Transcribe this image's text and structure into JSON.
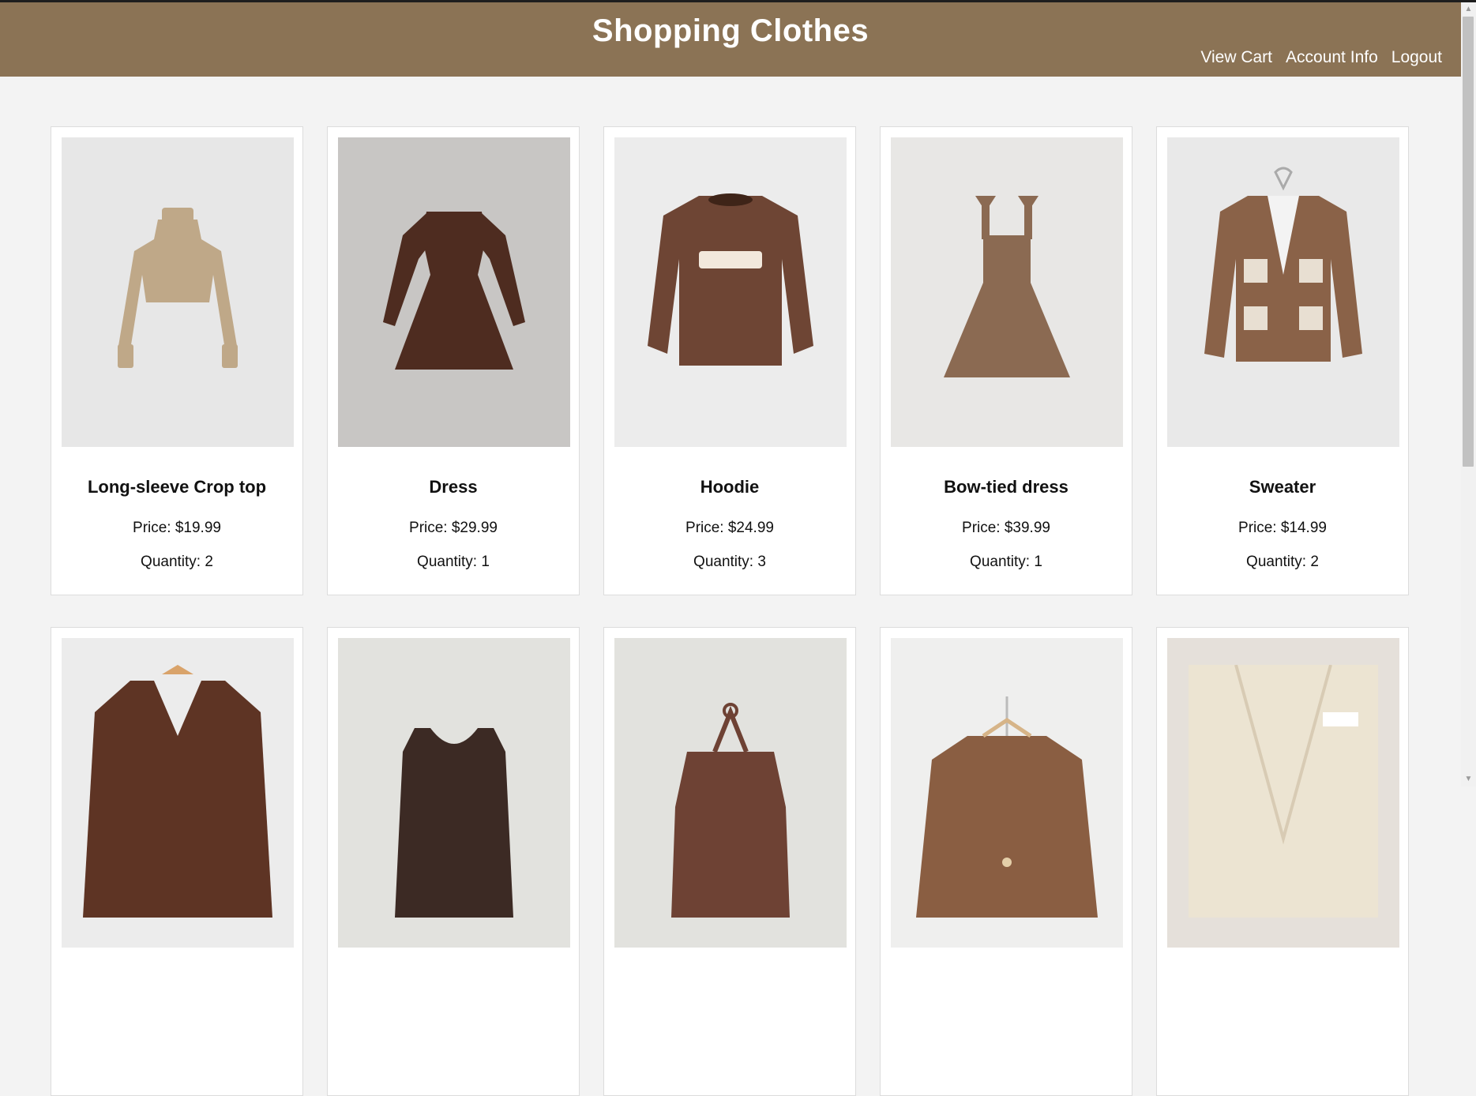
{
  "header": {
    "title": "Shopping Clothes",
    "nav": [
      "View Cart",
      "Account Info",
      "Logout"
    ],
    "bg_color": "#8b7355"
  },
  "products": [
    {
      "name": "Long-sleeve Crop top",
      "price": "Price: $19.99",
      "quantity": "Quantity: 2",
      "icon": "crop-top-icon",
      "bg": "#e7e7e7",
      "color": "#bfa888"
    },
    {
      "name": "Dress",
      "price": "Price: $29.99",
      "quantity": "Quantity: 1",
      "icon": "long-sleeve-dress-icon",
      "bg": "#c8c6c4",
      "color": "#4e2c20"
    },
    {
      "name": "Hoodie",
      "price": "Price: $24.99",
      "quantity": "Quantity: 3",
      "icon": "sweatshirt-icon",
      "bg": "#ececec",
      "color": "#6e4534"
    },
    {
      "name": "Bow-tied dress",
      "price": "Price: $39.99",
      "quantity": "Quantity: 1",
      "icon": "strap-dress-icon",
      "bg": "#e8e7e5",
      "color": "#8b6a52"
    },
    {
      "name": "Sweater",
      "price": "Price: $14.99",
      "quantity": "Quantity: 2",
      "icon": "cardigan-icon",
      "bg": "#e9e9e9",
      "color": "#8a6248"
    },
    {
      "name": "",
      "price": "",
      "quantity": "",
      "icon": "v-neck-sweater-icon",
      "bg": "#ececec",
      "color": "#5e3424"
    },
    {
      "name": "",
      "price": "",
      "quantity": "",
      "icon": "scoop-neck-top-icon",
      "bg": "#e2e2de",
      "color": "#3c2a24"
    },
    {
      "name": "",
      "price": "",
      "quantity": "",
      "icon": "halter-top-icon",
      "bg": "#e2e2de",
      "color": "#6e4234"
    },
    {
      "name": "",
      "price": "",
      "quantity": "",
      "icon": "cable-knit-cardigan-icon",
      "bg": "#efefee",
      "color": "#8a5e42"
    },
    {
      "name": "",
      "price": "",
      "quantity": "",
      "icon": "cream-cardigan-icon",
      "bg": "#e5e0da",
      "color": "#ece4d2"
    }
  ]
}
